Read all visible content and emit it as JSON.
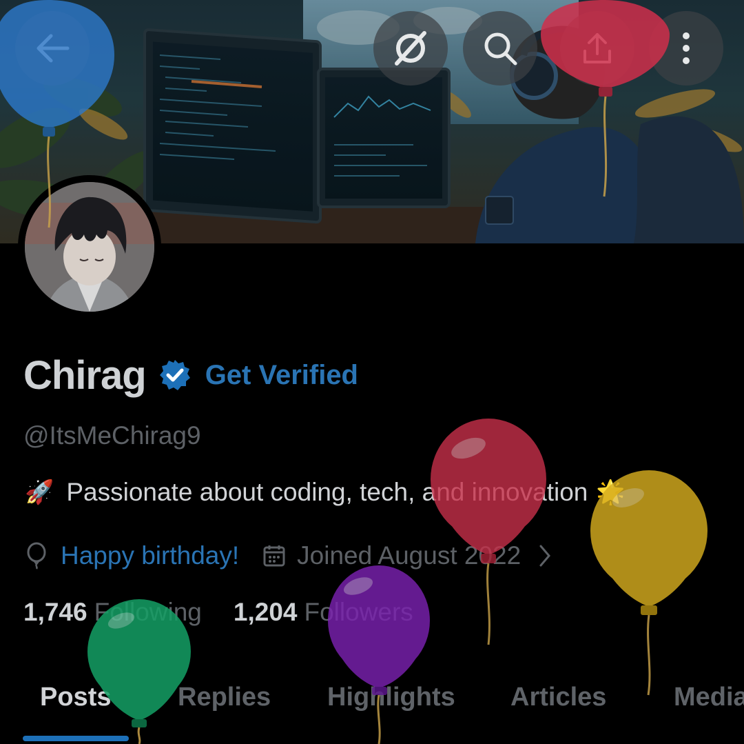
{
  "header": {
    "back_icon": "arrow-left-icon",
    "grok_icon": "grok-icon",
    "search_icon": "search-icon",
    "share_icon": "share-icon",
    "more_icon": "more-vertical-icon"
  },
  "profile": {
    "display_name": "Chirag",
    "verified_icon": "verified-badge-icon",
    "get_verified_label": "Get Verified",
    "handle": "@ItsMeChirag9",
    "bio_emoji_start": "🚀",
    "bio_text": "Passionate about coding, tech, and innovation",
    "bio_emoji_end": "🌟",
    "birthday_label": "Happy birthday!",
    "joined_label": "Joined August 2022",
    "following_count": "1,746",
    "following_label": "Following",
    "followers_count": "1,204",
    "followers_label": "Followers"
  },
  "tabs": [
    {
      "label": "Posts",
      "active": true
    },
    {
      "label": "Replies",
      "active": false
    },
    {
      "label": "Highlights",
      "active": false
    },
    {
      "label": "Articles",
      "active": false
    },
    {
      "label": "Media",
      "active": false
    }
  ],
  "colors": {
    "accent": "#1d70b8",
    "link": "#2a74b4",
    "background": "#000000"
  }
}
